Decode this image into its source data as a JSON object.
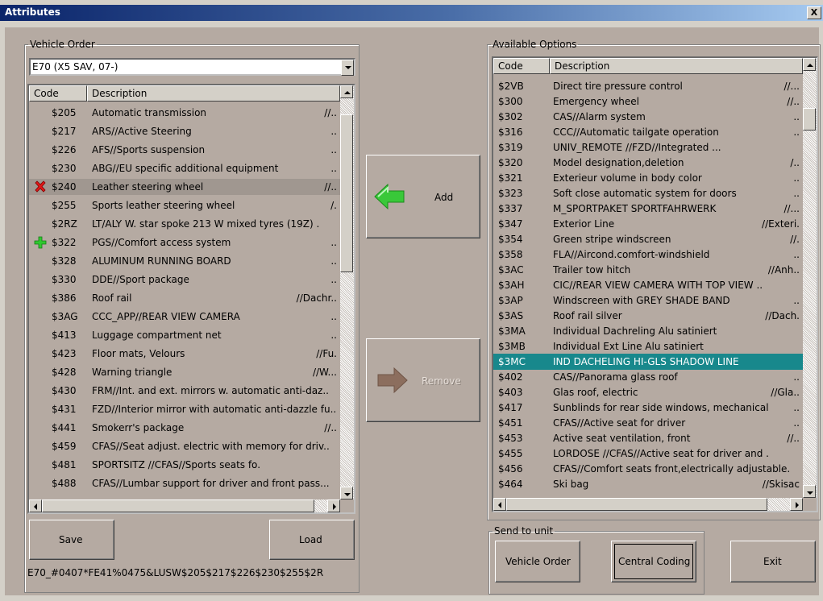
{
  "window": {
    "title": "Attributes",
    "close_label": "X"
  },
  "vehicle_order": {
    "legend": "Vehicle Order",
    "model_selected": "E70 (X5 SAV, 07-)",
    "columns": {
      "code": "Code",
      "description": "Description"
    },
    "rows": [
      {
        "code": "$205",
        "desc": "Automatic transmission",
        "tail": "//..",
        "marker": ""
      },
      {
        "code": "$217",
        "desc": "ARS//Active Steering",
        "tail": "..",
        "marker": ""
      },
      {
        "code": "$226",
        "desc": "AFS//Sports suspension",
        "tail": "..",
        "marker": ""
      },
      {
        "code": "$230",
        "desc": "ABG//EU specific additional equipment",
        "tail": "..",
        "marker": ""
      },
      {
        "code": "$240",
        "desc": "Leather steering wheel",
        "tail": "//..",
        "marker": "remove"
      },
      {
        "code": "$255",
        "desc": "Sports leather steering wheel",
        "tail": "/.",
        "marker": ""
      },
      {
        "code": "$2RZ",
        "desc": "LT/ALY W. star spoke 213 W mixed tyres (19Z) .",
        "tail": "",
        "marker": ""
      },
      {
        "code": "$322",
        "desc": "PGS//Comfort access system",
        "tail": "..",
        "marker": "add"
      },
      {
        "code": "$328",
        "desc": "ALUMINUM RUNNING BOARD",
        "tail": "..",
        "marker": ""
      },
      {
        "code": "$330",
        "desc": "DDE//Sport package",
        "tail": "..",
        "marker": ""
      },
      {
        "code": "$386",
        "desc": "Roof rail",
        "tail": "//Dachr..",
        "marker": ""
      },
      {
        "code": "$3AG",
        "desc": "CCC_APP//REAR VIEW CAMERA",
        "tail": "..",
        "marker": ""
      },
      {
        "code": "$413",
        "desc": "Luggage compartment net",
        "tail": "..",
        "marker": ""
      },
      {
        "code": "$423",
        "desc": "Floor mats, Velours",
        "tail": "//Fu.",
        "marker": ""
      },
      {
        "code": "$428",
        "desc": "Warning triangle",
        "tail": "//W...",
        "marker": ""
      },
      {
        "code": "$430",
        "desc": "FRM//Int. and ext. mirrors w. automatic anti-daz..",
        "tail": "",
        "marker": ""
      },
      {
        "code": "$431",
        "desc": "FZD//Interior mirror with automatic anti-dazzle fu..",
        "tail": "",
        "marker": ""
      },
      {
        "code": "$441",
        "desc": "Smokerr's package",
        "tail": "//..",
        "marker": ""
      },
      {
        "code": "$459",
        "desc": "CFAS//Seat adjust. electric with memory for driv..",
        "tail": "",
        "marker": ""
      },
      {
        "code": "$481",
        "desc": "SPORTSITZ          //CFAS//Sports seats fo.",
        "tail": "",
        "marker": ""
      },
      {
        "code": "$488",
        "desc": "CFAS//Lumbar support for driver and front pass...",
        "tail": "",
        "marker": ""
      }
    ]
  },
  "available_options": {
    "legend": "Available Options",
    "columns": {
      "code": "Code",
      "description": "Description"
    },
    "rows": [
      {
        "code": "$2VB",
        "desc": "Direct tire pressure control",
        "tail": "//..."
      },
      {
        "code": "$300",
        "desc": "Emergency wheel",
        "tail": "//.."
      },
      {
        "code": "$302",
        "desc": "CAS//Alarm system",
        "tail": ".."
      },
      {
        "code": "$316",
        "desc": "CCC//Automatic tailgate operation",
        "tail": ".."
      },
      {
        "code": "$319",
        "desc": "UNIV_REMOTE          //FZD//Integrated ...",
        "tail": ""
      },
      {
        "code": "$320",
        "desc": "Model designation,deletion",
        "tail": "/.."
      },
      {
        "code": "$321",
        "desc": "Exterieur volume in body color",
        "tail": ".."
      },
      {
        "code": "$323",
        "desc": "Soft close automatic system for doors",
        "tail": ".."
      },
      {
        "code": "$337",
        "desc": "M_SPORTPAKET SPORTFAHRWERK",
        "tail": "//..."
      },
      {
        "code": "$347",
        "desc": "Exterior Line",
        "tail": "//Exteri."
      },
      {
        "code": "$354",
        "desc": "Green stripe windscreen",
        "tail": "//."
      },
      {
        "code": "$358",
        "desc": "FLA//Aircond.comfort-windshield",
        "tail": ".."
      },
      {
        "code": "$3AC",
        "desc": "Trailer tow hitch",
        "tail": "//Anh.."
      },
      {
        "code": "$3AH",
        "desc": "CIC//REAR VIEW CAMERA WITH TOP VIEW ..",
        "tail": ""
      },
      {
        "code": "$3AP",
        "desc": "Windscreen with GREY SHADE BAND",
        "tail": ".."
      },
      {
        "code": "$3AS",
        "desc": "Roof rail silver",
        "tail": "//Dach."
      },
      {
        "code": "$3MA",
        "desc": "Individual Dachreling Alu satiniert",
        "tail": ""
      },
      {
        "code": "$3MB",
        "desc": "Individual Ext Line Alu satiniert",
        "tail": ""
      },
      {
        "code": "$3MC",
        "desc": "IND DACHELING HI-GLS SHADOW LINE",
        "tail": "",
        "highlight": true
      },
      {
        "code": "$402",
        "desc": "CAS//Panorama glass roof",
        "tail": ".."
      },
      {
        "code": "$403",
        "desc": "Glas roof, electric",
        "tail": "//Gla.."
      },
      {
        "code": "$417",
        "desc": "Sunblinds for rear side windows, mechanical",
        "tail": ".."
      },
      {
        "code": "$451",
        "desc": "CFAS//Active seat for driver",
        "tail": ".."
      },
      {
        "code": "$453",
        "desc": "Active seat ventilation, front",
        "tail": "//.."
      },
      {
        "code": "$455",
        "desc": "LORDOSE   //CFAS//Active seat for driver and .",
        "tail": ""
      },
      {
        "code": "$456",
        "desc": "CFAS//Comfort seats front,electrically adjustable.",
        "tail": ""
      },
      {
        "code": "$464",
        "desc": "Ski bag",
        "tail": "//Skisac"
      }
    ]
  },
  "buttons": {
    "add": "Add",
    "remove": "Remove",
    "save": "Save",
    "load": "Load",
    "vehicle_order": "Vehicle Order",
    "central_coding": "Central Coding",
    "exit": "Exit"
  },
  "send_to_unit": {
    "legend": "Send to unit"
  },
  "order_string": "E70_#0407*FE41%0475&LUSW$205$217$226$230$255$2R",
  "colors": {
    "highlight": "#18888c",
    "add_arrow": "#39c839",
    "remove_arrow": "#8c6e5e",
    "title_bar": "#0a246a"
  }
}
